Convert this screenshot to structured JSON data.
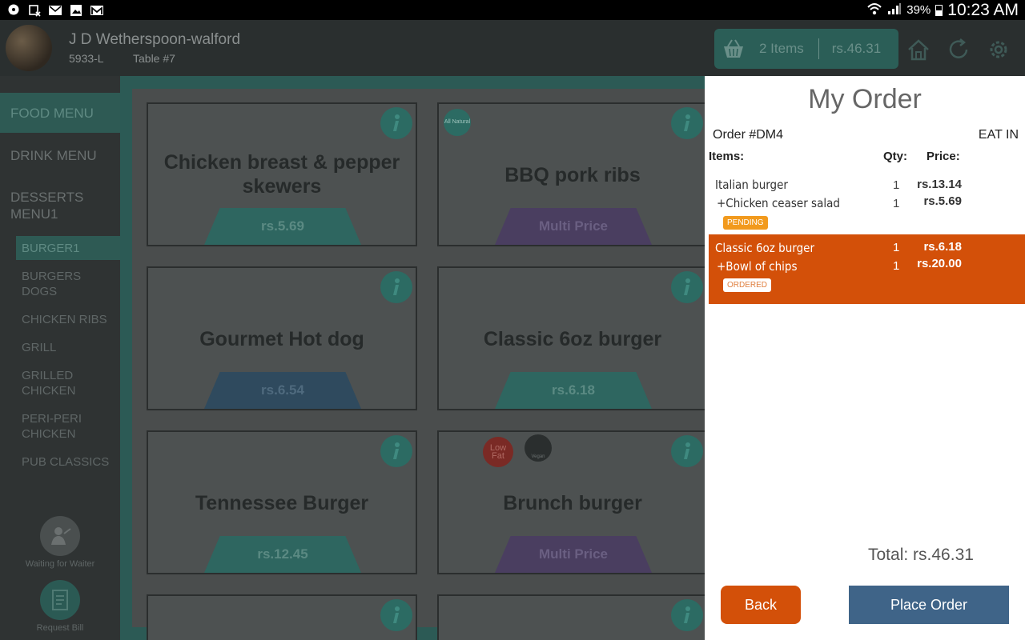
{
  "statusbar": {
    "battery": "39%",
    "time": "10:23 AM"
  },
  "header": {
    "venue_name": "J D Wetherspoon-walford",
    "venue_id": "5933-L",
    "table": "Table #7",
    "cart_count": "2 Items",
    "cart_total": "rs.46.31"
  },
  "sidebar": {
    "categories": [
      {
        "label": "FOOD MENU",
        "active": true
      },
      {
        "label": "DRINK MENU",
        "active": false
      },
      {
        "label": "DESSERTS MENU1",
        "active": false
      }
    ],
    "subcategories": [
      {
        "label": "BURGER1",
        "active": true
      },
      {
        "label": "BURGERS DOGS",
        "active": false
      },
      {
        "label": "CHICKEN RIBS",
        "active": false
      },
      {
        "label": "GRILL",
        "active": false
      },
      {
        "label": "GRILLED CHICKEN",
        "active": false
      },
      {
        "label": "PERI-PERI CHICKEN",
        "active": false
      },
      {
        "label": "PUB CLASSICS",
        "active": false
      }
    ],
    "waiter_label": "Waiting for Waiter",
    "bill_label": "Request Bill"
  },
  "menu_items": [
    {
      "title": "Chicken breast & pepper skewers",
      "price": "rs.5.69",
      "style": "teal"
    },
    {
      "title": "BBQ pork ribs",
      "price": "Multi Price",
      "style": "purple",
      "badge": "All Natural"
    },
    {
      "title": "Gourmet Hot dog",
      "price": "rs.6.54",
      "style": "blue"
    },
    {
      "title": "Classic 6oz burger",
      "price": "rs.6.18",
      "style": "teal"
    },
    {
      "title": "Tennessee Burger",
      "price": "rs.12.45",
      "style": "teal"
    },
    {
      "title": "Brunch burger",
      "price": "Multi Price",
      "style": "purple",
      "badges": [
        "Low Fat",
        "Vegan"
      ]
    }
  ],
  "order": {
    "title": "My Order",
    "order_number": "Order #DM4",
    "type": "EAT IN",
    "col_items": "Items:",
    "col_qty": "Qty:",
    "col_price": "Price:",
    "entries": [
      {
        "lines": [
          {
            "name": "Italian burger",
            "qty": "1",
            "price": "rs.13.14"
          },
          {
            "name": "+Chicken ceaser salad",
            "qty": "1",
            "price": "rs.5.69"
          }
        ],
        "status": "PENDING"
      },
      {
        "lines": [
          {
            "name": "Classic 6oz burger",
            "qty": "1",
            "price": "rs.6.18"
          },
          {
            "name": "+Bowl of chips",
            "qty": "1",
            "price": "rs.20.00"
          }
        ],
        "status": "ORDERED"
      }
    ],
    "total_label": "Total:",
    "total_value": "rs.46.31",
    "back_label": "Back",
    "place_label": "Place Order"
  },
  "colors": {
    "accent": "#d35009",
    "place_button": "#3f6488",
    "pending": "#f29a1d"
  }
}
